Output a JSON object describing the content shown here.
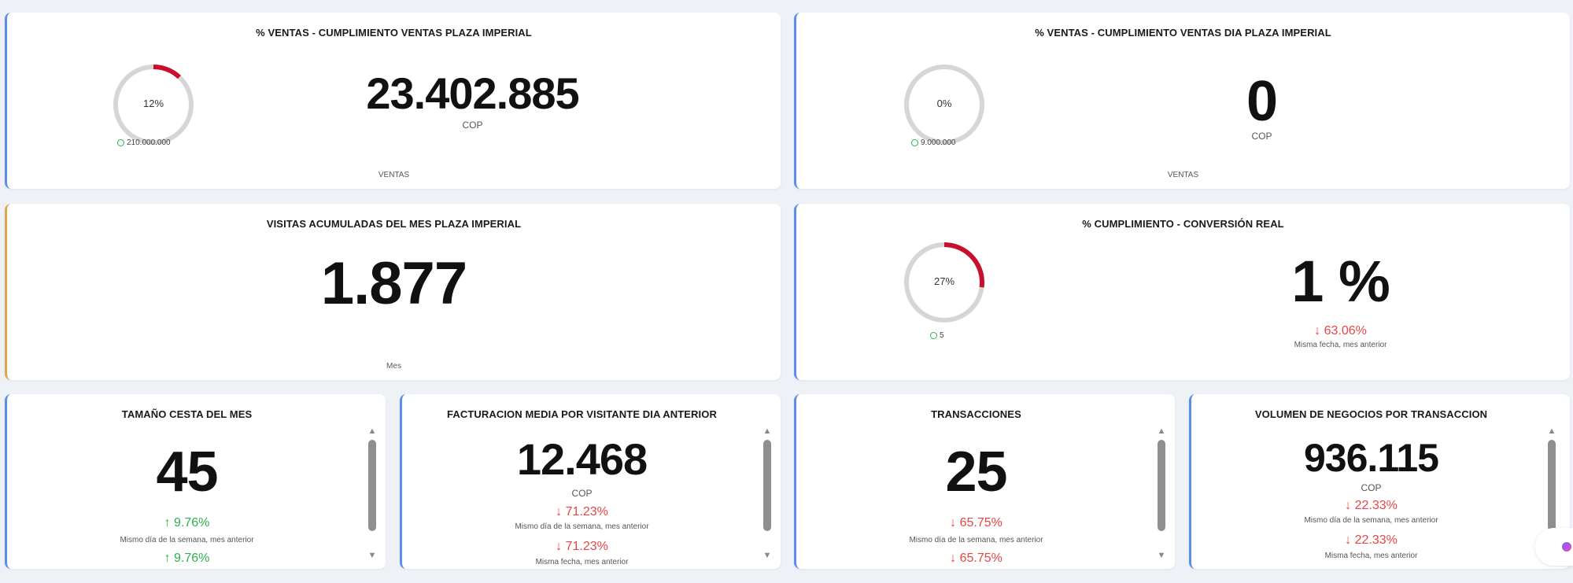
{
  "card1": {
    "title": "% VENTAS - CUMPLIMIENTO VENTAS PLAZA IMPERIAL",
    "gauge_label": "12%",
    "gauge_fraction": 0.12,
    "target": "210.000.000",
    "value": "23.402.885",
    "unit": "COP",
    "footer": "VENTAS"
  },
  "card2": {
    "title": "% VENTAS - CUMPLIMIENTO VENTAS DIA PLAZA IMPERIAL",
    "gauge_label": "0%",
    "gauge_fraction": 0,
    "target": "9.000.000",
    "value": "0",
    "unit": "COP",
    "footer": "VENTAS"
  },
  "card3": {
    "title": "VISITAS ACUMULADAS DEL MES PLAZA IMPERIAL",
    "value": "1.877",
    "footer": "Mes"
  },
  "card4": {
    "title": "% CUMPLIMIENTO - CONVERSIÓN REAL",
    "gauge_label": "27%",
    "gauge_fraction": 0.27,
    "target": "5",
    "value": "1 %",
    "delta": "↓ 63.06%",
    "note": "Misma fecha, mes anterior"
  },
  "card5": {
    "title": "TAMAÑO CESTA DEL MES",
    "value": "45",
    "delta1": "↑ 9.76%",
    "note1": "Mismo día de la semana, mes anterior",
    "delta2": "↑ 9.76%"
  },
  "card6": {
    "title": "FACTURACION MEDIA POR VISITANTE DIA ANTERIOR",
    "value": "12.468",
    "unit": "COP",
    "delta1": "↓ 71.23%",
    "note1": "Mismo día de la semana, mes anterior",
    "delta2": "↓ 71.23%",
    "note2": "Misma fecha, mes anterior"
  },
  "card7": {
    "title": "TRANSACCIONES",
    "value": "25",
    "delta1": "↓ 65.75%",
    "note1": "Mismo día de la semana, mes anterior",
    "delta2": "↓ 65.75%"
  },
  "card8": {
    "title": "VOLUMEN DE NEGOCIOS POR TRANSACCION",
    "value": "936.115",
    "unit": "COP",
    "delta1": "↓ 22.33%",
    "note1": "Mismo día de la semana, mes anterior",
    "delta2": "↓ 22.33%",
    "note2": "Misma fecha, mes anterior"
  },
  "colors": {
    "accent_blue": "#5b8def",
    "accent_orange": "#e0a54a",
    "gauge_fill": "#c8102e",
    "gauge_track": "#d6d6d6",
    "positive": "#2bb24c",
    "negative": "#e64545"
  }
}
